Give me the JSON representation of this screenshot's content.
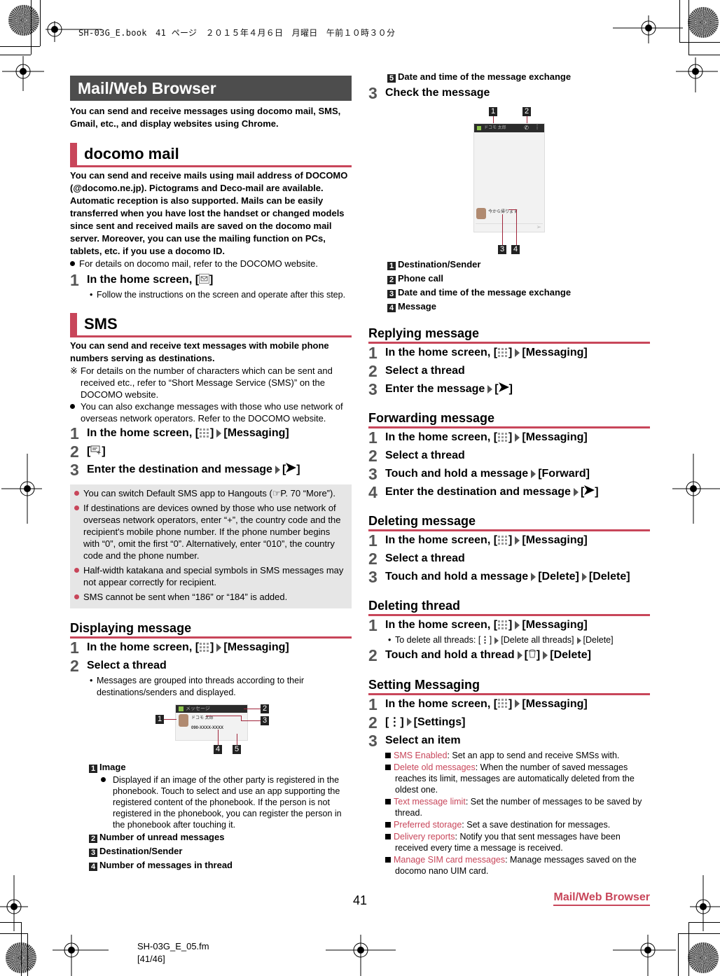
{
  "print_header": "SH-03G_E.book　41 ページ　２０１５年４月６日　月曜日　午前１０時３０分",
  "banner": "Mail/Web Browser",
  "intro": "You can send and receive messages using docomo mail, SMS, Gmail, etc., and display websites using Chrome.",
  "docomo_mail": {
    "title": "docomo mail",
    "lead": "You can send and receive mails using mail address of DOCOMO (@docomo.ne.jp). Pictograms and Deco-mail are available. Automatic reception is also supported. Mails can be easily transferred when you have lost the handset or changed models since sent and received mails are saved on the docomo mail server. Moreover, you can use the mailing function on PCs, tablets, etc. if you use a docomo ID.",
    "note": "For details on docomo mail, refer to the DOCOMO website.",
    "steps": [
      {
        "num": "1",
        "text_before": "In the home screen, [",
        "icon": "mail-icon",
        "text_after": "]",
        "sub": "Follow the instructions on the screen and operate after this step."
      }
    ]
  },
  "sms": {
    "title": "SMS",
    "lead": "You can send and receive text messages with mobile phone numbers serving as destinations.",
    "notes": [
      {
        "mark": "※",
        "text": "For details on the number of characters which can be sent and received etc., refer to “Short Message Service (SMS)” on the DOCOMO website."
      },
      {
        "mark": "●",
        "text": "You can also exchange messages with those who use network of overseas network operators. Refer to the DOCOMO website."
      }
    ],
    "steps": [
      {
        "num": "1",
        "a": "In the home screen, [",
        "b": "]",
        "c": "[Messaging]"
      },
      {
        "num": "2",
        "a": "[",
        "b": "]"
      },
      {
        "num": "3",
        "a": "Enter the destination and message",
        "b": "[",
        "c": "]"
      }
    ],
    "memo": [
      "You can switch Default SMS app to Hangouts (☞P. 70 “More”).",
      "If destinations are devices owned by those who use network of overseas network operators, enter “+”, the country code and the recipient's mobile phone number. If the phone number begins with “0”, omit the first “0”. Alternatively, enter “010”, the country code and the phone number.",
      "Half-width katakana and special symbols in SMS messages may not appear correctly for recipient.",
      "SMS cannot be sent when “186” or “184” is added."
    ]
  },
  "displaying": {
    "title": "Displaying message",
    "step1": {
      "num": "1",
      "a": "In the home screen, [",
      "b": "]",
      "c": "[Messaging]"
    },
    "step2": {
      "num": "2",
      "text": "Select a thread",
      "sub": "Messages are grouped into threads according to their destinations/senders and displayed."
    },
    "callouts": [
      {
        "n": "1",
        "label": "Image",
        "sub": "Displayed if an image of the other party is registered in the phonebook. Touch to select and use an app supporting the registered content of the phonebook. If the person is not registered in the phonebook, you can register the person in the phonebook after touching it."
      },
      {
        "n": "2",
        "label": "Number of unread messages"
      },
      {
        "n": "3",
        "label": "Destination/Sender"
      },
      {
        "n": "4",
        "label": "Number of messages in thread"
      },
      {
        "n": "5",
        "label": "Date and time of the message exchange"
      }
    ],
    "step3": {
      "num": "3",
      "text": "Check the message"
    },
    "check_callouts": [
      {
        "n": "1",
        "label": "Destination/Sender"
      },
      {
        "n": "2",
        "label": "Phone call"
      },
      {
        "n": "3",
        "label": "Date and time of the message exchange"
      },
      {
        "n": "4",
        "label": "Message"
      }
    ],
    "screen_thread": {
      "app_title": "メッセージ",
      "contact": "ドコモ 太郎",
      "number": "090-XXXX-XXXX"
    },
    "screen_message": {
      "contact": "ドコモ 太郎",
      "bubble": "今から帰ります"
    }
  },
  "replying": {
    "title": "Replying message",
    "steps": [
      {
        "num": "1",
        "a": "In the home screen, [",
        "b": "]",
        "c": "[Messaging]"
      },
      {
        "num": "2",
        "text": "Select a thread"
      },
      {
        "num": "3",
        "a": "Enter the message",
        "b": "[",
        "c": "]"
      }
    ]
  },
  "forwarding": {
    "title": "Forwarding message",
    "steps": [
      {
        "num": "1",
        "a": "In the home screen, [",
        "b": "]",
        "c": "[Messaging]"
      },
      {
        "num": "2",
        "text": "Select a thread"
      },
      {
        "num": "3",
        "a": "Touch and hold a message",
        "c": "[Forward]"
      },
      {
        "num": "4",
        "a": "Enter the destination and message",
        "b": "[",
        "c": "]"
      }
    ]
  },
  "deleting_message": {
    "title": "Deleting message",
    "steps": [
      {
        "num": "1",
        "a": "In the home screen, [",
        "b": "]",
        "c": "[Messaging]"
      },
      {
        "num": "2",
        "text": "Select a thread"
      },
      {
        "num": "3",
        "a": "Touch and hold a message",
        "c": "[Delete]",
        "d": "[Delete]"
      }
    ]
  },
  "deleting_thread": {
    "title": "Deleting thread",
    "steps": [
      {
        "num": "1",
        "a": "In the home screen, [",
        "b": "]",
        "c": "[Messaging]",
        "sub_a": "To delete all threads: [",
        "sub_b": "]",
        "sub_c": "[Delete all threads]",
        "sub_d": "[Delete]"
      },
      {
        "num": "2",
        "a": "Touch and hold a thread",
        "b": "[",
        "c": "]",
        "d": "[Delete]"
      }
    ]
  },
  "setting": {
    "title": "Setting Messaging",
    "steps": [
      {
        "num": "1",
        "a": "In the home screen, [",
        "b": "]",
        "c": "[Messaging]"
      },
      {
        "num": "2",
        "a": "[",
        "b": "]",
        "c": "[Settings]"
      },
      {
        "num": "3",
        "text": "Select an item"
      }
    ],
    "items": [
      {
        "term": "SMS Enabled",
        "desc": ": Set an app to send and receive SMSs with."
      },
      {
        "term": "Delete old messages",
        "desc": ": When the number of saved messages reaches its limit, messages are automatically deleted from the oldest one."
      },
      {
        "term": "Text message limit",
        "desc": ": Set the number of messages to be saved by thread."
      },
      {
        "term": "Preferred storage",
        "desc": ": Set a save destination for messages."
      },
      {
        "term": "Delivery reports",
        "desc": ": Notify you that sent messages have been received every time a message is received."
      },
      {
        "term": "Manage SIM card messages",
        "desc": ": Manage messages saved on the docomo nano UIM card."
      }
    ]
  },
  "footer": {
    "page_number": "41",
    "section": "Mail/Web Browser",
    "file": "SH-03G_E_05.fm",
    "pages": "[41/46]"
  },
  "colors": {
    "accent": "#c8465a",
    "banner_bg": "#4d4d4d",
    "memo_bg": "#e6e6e6"
  }
}
